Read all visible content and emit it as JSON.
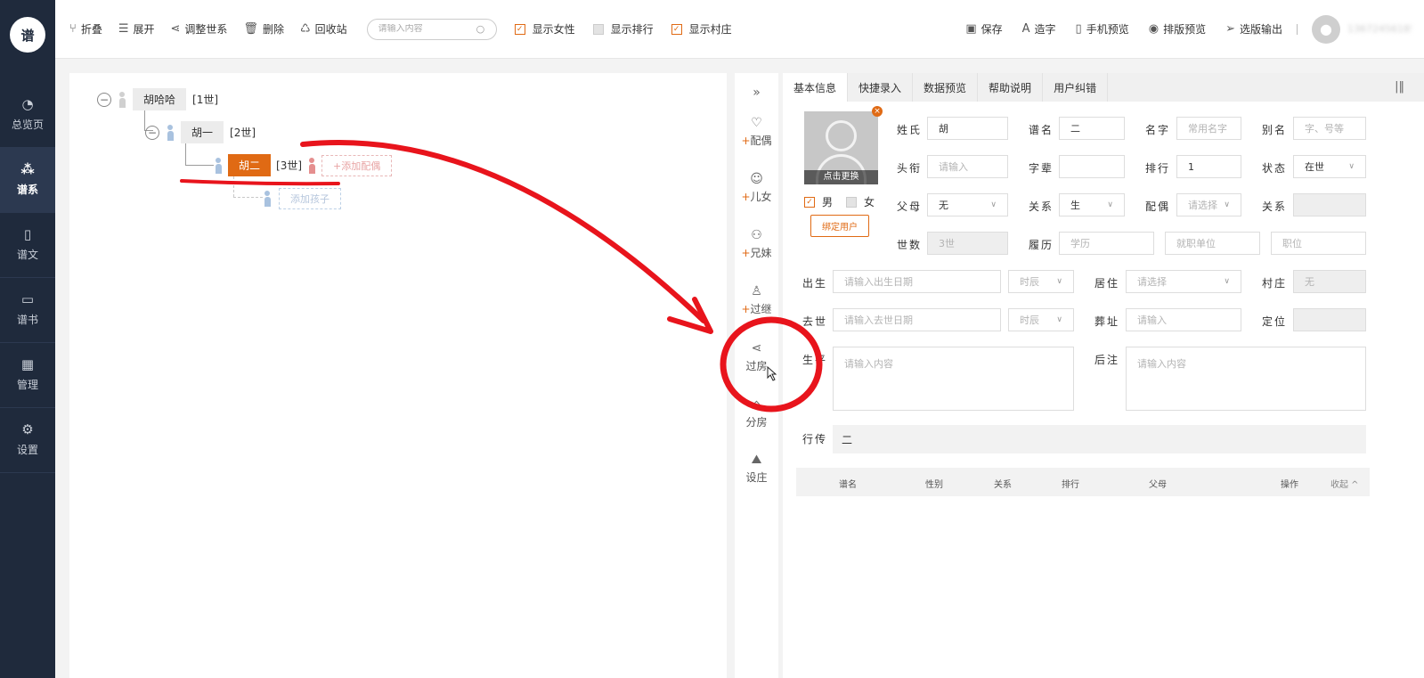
{
  "app": {
    "logo_text": "谱"
  },
  "sidebar": {
    "items": [
      {
        "label": "总览页",
        "icon": "pie-chart-icon"
      },
      {
        "label": "谱系",
        "icon": "family-tree-icon",
        "active": true
      },
      {
        "label": "谱文",
        "icon": "document-icon"
      },
      {
        "label": "谱书",
        "icon": "book-icon"
      },
      {
        "label": "管理",
        "icon": "grid-icon"
      },
      {
        "label": "设置",
        "icon": "gear-icon"
      }
    ]
  },
  "toolbar": {
    "fold": "折叠",
    "expand": "展开",
    "adjust": "调整世系",
    "delete": "删除",
    "recycle": "回收站",
    "search_placeholder": "请输入内容",
    "show_female": "显示女性",
    "show_female_checked": true,
    "show_rank": "显示排行",
    "show_rank_checked": false,
    "show_village": "显示村庄",
    "show_village_checked": true,
    "save": "保存",
    "make_char": "造字",
    "mobile_preview": "手机预览",
    "layout_preview": "排版预览",
    "select_output": "选版输出",
    "username": "13672456185"
  },
  "tree": {
    "nodes": [
      {
        "name": "胡哈哈",
        "gen": "[1世]"
      },
      {
        "name": "胡一",
        "gen": "[2世]"
      },
      {
        "name": "胡二",
        "gen": "[3世]"
      }
    ],
    "add_spouse": "+添加配偶",
    "add_child": "添加孩子"
  },
  "actions": [
    {
      "label": "配偶",
      "plus": "+",
      "icon": "heart-person-icon"
    },
    {
      "label": "儿女",
      "plus": "+",
      "icon": "baby-icon"
    },
    {
      "label": "兄妹",
      "plus": "+",
      "icon": "siblings-icon"
    },
    {
      "label": "过继",
      "plus": "+",
      "icon": "person-icon"
    },
    {
      "label": "过房",
      "plus": "",
      "icon": "share-icon"
    },
    {
      "label": "分房",
      "plus": "",
      "icon": "house-icon"
    },
    {
      "label": "设庄",
      "plus": "",
      "icon": "landscape-icon"
    }
  ],
  "tabs": [
    "基本信息",
    "快捷录入",
    "数据预览",
    "帮助说明",
    "用户纠错"
  ],
  "form": {
    "photo_caption": "点击更换",
    "male": "男",
    "female": "女",
    "male_checked": true,
    "bind_user": "绑定用户",
    "surname_label": "姓氏",
    "surname": "胡",
    "pu_name_label": "谱名",
    "pu_name": "二",
    "given_name_label": "名字",
    "given_name_ph": "常用名字",
    "alias_label": "别名",
    "alias_ph": "字、号等",
    "title_label": "头衔",
    "title_ph": "请输入",
    "zibei_label": "字辈",
    "zibei": "",
    "rank_label": "排行",
    "rank": "1",
    "status_label": "状态",
    "status": "在世",
    "parents_label": "父母",
    "parents": "无",
    "relation_label": "关系",
    "relation": "生",
    "spouse_label": "配偶",
    "spouse_ph": "请选择",
    "relation2_label": "关系",
    "gen_label": "世数",
    "gen": "3世",
    "resume_label": "履历",
    "edu_ph": "学历",
    "work_ph": "就职单位",
    "post_ph": "职位",
    "birth_label": "出生",
    "birth_ph": "请输入出生日期",
    "hour_ph": "时辰",
    "reside_label": "居住",
    "reside_ph": "请选择",
    "village_label": "村庄",
    "village": "无",
    "death_label": "去世",
    "death_ph": "请输入去世日期",
    "hour2_ph": "时辰",
    "burial_label": "葬址",
    "burial_ph": "请输入",
    "locate_label": "定位",
    "bio_label": "生平",
    "bio_ph": "请输入内容",
    "note_label": "后注",
    "note_ph": "请输入内容",
    "hang_label": "行传",
    "hang": "二"
  },
  "table": {
    "headers": [
      "谱名",
      "性别",
      "关系",
      "排行",
      "父母",
      "操作"
    ],
    "collapse": "收起 ^"
  },
  "colors": {
    "accent": "#e06a14",
    "sidebar": "#1f2a3c",
    "annotation": "#e8141c"
  }
}
